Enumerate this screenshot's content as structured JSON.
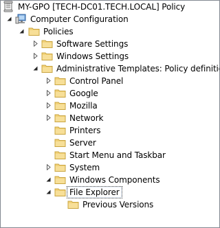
{
  "tree": {
    "root": {
      "label": "MY-GPO [TECH-DC01.TECH.LOCAL] Policy",
      "icon": "gpo-scroll-icon"
    },
    "computer_configuration": {
      "label": "Computer Configuration",
      "icon": "computer-icon"
    },
    "policies": {
      "label": "Policies"
    },
    "software_settings": {
      "label": "Software Settings"
    },
    "windows_settings": {
      "label": "Windows Settings"
    },
    "administrative_templates": {
      "label": "Administrative Templates: Policy definitions"
    },
    "control_panel": {
      "label": "Control Panel"
    },
    "google": {
      "label": "Google"
    },
    "mozilla": {
      "label": "Mozilla"
    },
    "network": {
      "label": "Network"
    },
    "printers": {
      "label": "Printers"
    },
    "server": {
      "label": "Server"
    },
    "start_menu": {
      "label": "Start Menu and Taskbar"
    },
    "system": {
      "label": "System"
    },
    "windows_components": {
      "label": "Windows Components"
    },
    "file_explorer": {
      "label": "File Explorer",
      "selected": true
    },
    "previous_versions": {
      "label": "Previous Versions"
    }
  },
  "colors": {
    "folder": "#f2d27a",
    "folder_edge": "#c9a43f",
    "selection_border": "#404040",
    "tree_border": "#828790"
  }
}
